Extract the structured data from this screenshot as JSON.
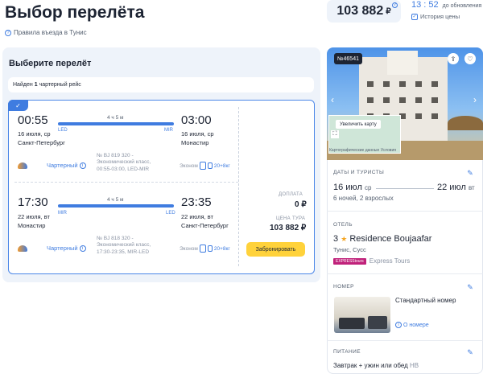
{
  "header": {
    "title": "Выбор перелёта",
    "rules_link": "Правила въезда в Тунис",
    "price": "103 882",
    "currency": "₽",
    "timer": "13 : 52",
    "timer_caption": "до обновления",
    "price_history": "История цены"
  },
  "flights_panel": {
    "title": "Выберите перелёт",
    "found_prefix": "Найден",
    "found_count": "1",
    "found_suffix": "чартерный рейс",
    "outbound": {
      "dep_time": "00:55",
      "arr_time": "03:00",
      "duration": "4 ч 5 м",
      "dep_code": "LED",
      "arr_code": "MIR",
      "dep_date": "16 июля, ср",
      "arr_date": "16 июля, ср",
      "dep_city": "Санкт-Петербург",
      "arr_city": "Монастир",
      "airline_type": "Чартерный",
      "info_line1": "№ BJ 819 320 -",
      "info_line2": "Экономический класс,",
      "info_line3": "00:55-03:00, LED-MIR",
      "class_label": "Эконом",
      "bag_count": "20+8кг"
    },
    "return": {
      "dep_time": "17:30",
      "arr_time": "23:35",
      "duration": "4 ч 5 м",
      "dep_code": "MIR",
      "arr_code": "LED",
      "dep_date": "22 июля, вт",
      "arr_date": "22 июля, вт",
      "dep_city": "Монастир",
      "arr_city": "Санкт-Петербург",
      "airline_type": "Чартерный",
      "info_line1": "№ BJ 818 320 -",
      "info_line2": "Экономический класс,",
      "info_line3": "17:30-23:35, MIR-LED",
      "class_label": "Эконом",
      "bag_count": "20+8кг"
    },
    "surcharge_label": "ДОПЛАТА",
    "surcharge_value": "0 ₽",
    "tour_price_label": "ЦЕНА ТУРА",
    "tour_price_value": "103 882 ₽",
    "book_button": "Забронировать"
  },
  "hotel_card": {
    "id_tag": "№46541",
    "map_button": "Увеличить карту",
    "map_caption": "Картографические данные   Условия",
    "dates_label": "ДАТЫ И ТУРИСТЫ",
    "date_from": "16 июл",
    "date_from_day": "ср",
    "date_to": "22 июл",
    "date_to_day": "вт",
    "nights_tourists": "6 ночей, 2 взрослых",
    "hotel_label": "ОТЕЛЬ",
    "stars": "3",
    "hotel_name": "Residence Boujaafar",
    "location": "Тунис, Сусс",
    "operator_badge": "EXPRESStours",
    "operator_name": "Express Tours",
    "room_label": "НОМЕР",
    "room_name": "Стандартный номер",
    "room_link": "О номере",
    "meal_label": "ПИТАНИЕ",
    "meal_name": "Завтрак + ужин или обед",
    "meal_code": "HB"
  },
  "icons": [
    "question-icon",
    "checkbox-icon",
    "check-icon",
    "info-icon",
    "baggage-icon",
    "share-icon",
    "heart-icon",
    "edit-icon",
    "fullscreen-icon",
    "arrow-left-icon",
    "arrow-right-icon"
  ],
  "colors": {
    "accent": "#3f7ce0",
    "book_button": "#ffd23b",
    "panel_bg": "#eef3fa",
    "star": "#f5a623"
  }
}
